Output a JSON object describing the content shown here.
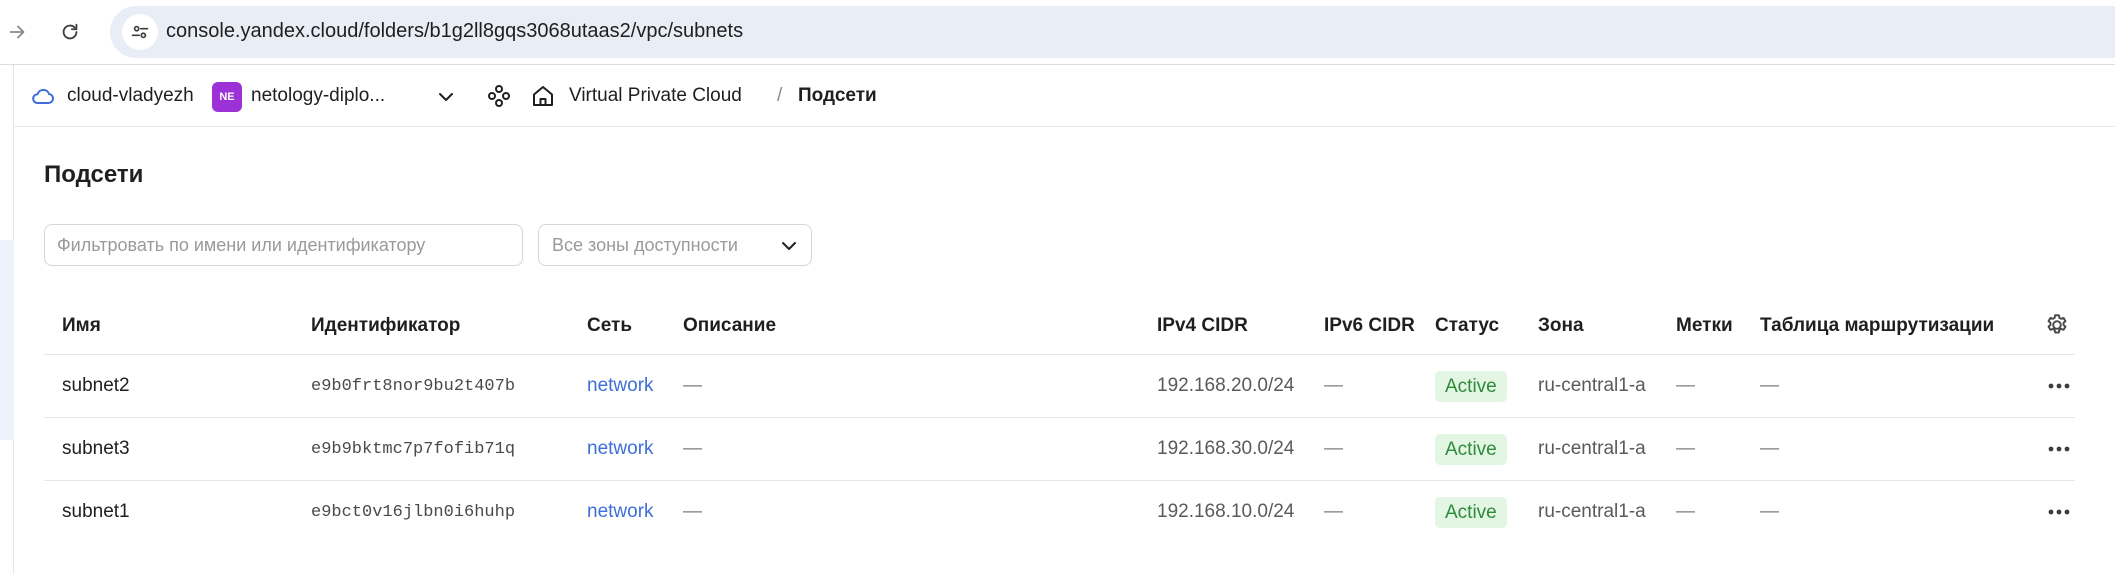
{
  "browser": {
    "url": "console.yandex.cloud/folders/b1g2ll8gqs3068utaas2/vpc/subnets",
    "icons": {
      "forward": "arrow-right-icon",
      "reload": "reload-icon",
      "site_info": "tune-icon"
    }
  },
  "header": {
    "cloud_name": "cloud-vladyezh",
    "folder_avatar": "NE",
    "folder_name": "netology-diplo...",
    "breadcrumb_service": "Virtual Private Cloud",
    "breadcrumb_separator": "/",
    "breadcrumb_current": "Подсети",
    "colors": {
      "avatar": "#9b31d6",
      "cloud_icon": "#3e6ed8"
    }
  },
  "page": {
    "title": "Подсети",
    "filter_placeholder": "Фильтровать по имени или идентификатору",
    "zone_select_label": "Все зоны доступности"
  },
  "table": {
    "columns": {
      "name": "Имя",
      "id": "Идентификатор",
      "network": "Сеть",
      "description": "Описание",
      "ipv4": "IPv4 CIDR",
      "ipv6": "IPv6 CIDR",
      "status": "Статус",
      "zone": "Зона",
      "labels": "Метки",
      "route_table": "Таблица маршрутизации"
    },
    "rows": [
      {
        "name": "subnet2",
        "id": "e9b0frt8nor9bu2t407b",
        "network": "network",
        "description": "—",
        "ipv4": "192.168.20.0/24",
        "ipv6": "—",
        "status": "Active",
        "zone": "ru-central1-a",
        "labels": "—",
        "route_table": "—"
      },
      {
        "name": "subnet3",
        "id": "e9b9bktmc7p7fofib71q",
        "network": "network",
        "description": "—",
        "ipv4": "192.168.30.0/24",
        "ipv6": "—",
        "status": "Active",
        "zone": "ru-central1-a",
        "labels": "—",
        "route_table": "—"
      },
      {
        "name": "subnet1",
        "id": "e9bct0v16jlbn0i6huhp",
        "network": "network",
        "description": "—",
        "ipv4": "192.168.10.0/24",
        "ipv6": "—",
        "status": "Active",
        "zone": "ru-central1-a",
        "labels": "—",
        "route_table": "—"
      }
    ],
    "colors": {
      "link": "#3e6ed8",
      "status_bg": "#e3f6e4",
      "status_text": "#2f8a3a"
    }
  }
}
